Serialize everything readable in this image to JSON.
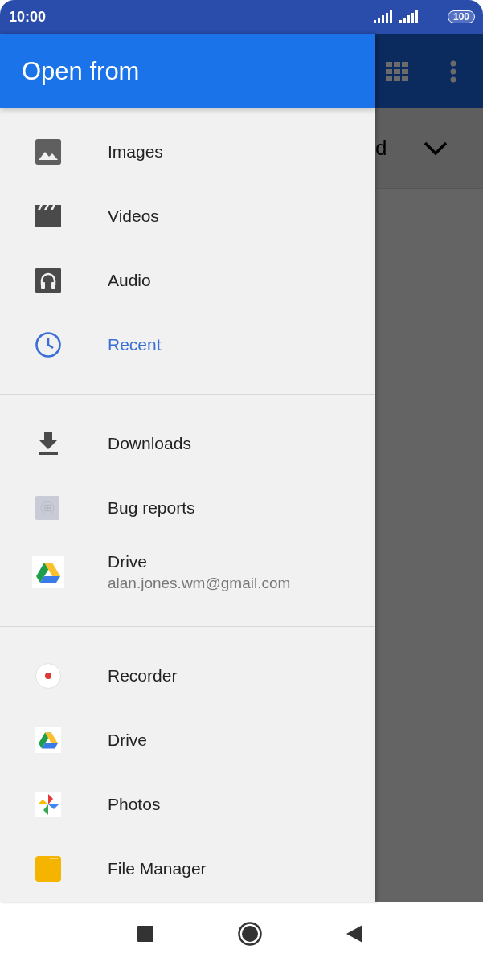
{
  "status_bar": {
    "time": "10:00",
    "battery": "100"
  },
  "drawer": {
    "title": "Open from",
    "sections": [
      {
        "items": [
          {
            "kind": "image",
            "label": "Images",
            "selected": false
          },
          {
            "kind": "video",
            "label": "Videos",
            "selected": false
          },
          {
            "kind": "audio",
            "label": "Audio",
            "selected": false
          },
          {
            "kind": "recent",
            "label": "Recent",
            "selected": true
          }
        ]
      },
      {
        "items": [
          {
            "kind": "download",
            "label": "Downloads",
            "selected": false
          },
          {
            "kind": "bug",
            "label": "Bug reports",
            "selected": false
          },
          {
            "kind": "drive",
            "label": "Drive",
            "subtitle": "alan.jones.wm@gmail.com",
            "selected": false
          }
        ]
      },
      {
        "items": [
          {
            "kind": "recorder",
            "label": "Recorder",
            "selected": false
          },
          {
            "kind": "drive",
            "label": "Drive",
            "selected": false
          },
          {
            "kind": "photos",
            "label": "Photos",
            "selected": false
          },
          {
            "kind": "folder",
            "label": "File Manager",
            "selected": false
          }
        ]
      }
    ]
  },
  "background": {
    "sort_label": "d"
  }
}
